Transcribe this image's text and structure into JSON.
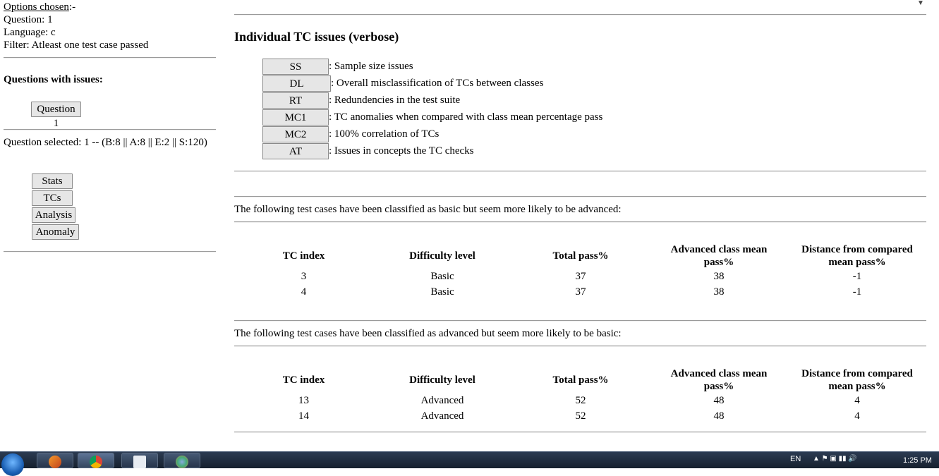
{
  "options": {
    "heading": "Options chosen",
    "heading_suffix": ":-",
    "question": "Question: 1",
    "language": "Language: c",
    "filter": "Filter: Atleast one test case passed"
  },
  "questions_with_issues": {
    "heading": "Questions with issues:",
    "items": [
      "Question 1"
    ]
  },
  "question_selected": "Question selected: 1 -- (B:8 || A:8 || E:2 || S:120)",
  "nav_buttons": [
    "Stats",
    "TCs",
    "Analysis",
    "Anomaly"
  ],
  "main": {
    "title": "Individual TC issues (verbose)",
    "legend": [
      {
        "code": "SS",
        "desc": ": Sample size issues"
      },
      {
        "code": "DL",
        "desc": ": Overall misclassification of TCs between classes"
      },
      {
        "code": "RT",
        "desc": ": Redundencies in the test suite"
      },
      {
        "code": "MC1",
        "desc": ": TC anomalies when compared with class mean percentage pass"
      },
      {
        "code": "MC2",
        "desc": ": 100% correlation of TCs"
      },
      {
        "code": "AT",
        "desc": ": Issues in concepts the TC checks"
      }
    ],
    "section1": {
      "text": "The following test cases have been classified as basic but seem more likely to be advanced:",
      "headers": [
        "TC index",
        "Difficulty level",
        "Total pass%",
        "Advanced class mean pass%",
        "Distance from compared mean pass%"
      ],
      "rows": [
        [
          "3",
          "Basic",
          "37",
          "38",
          "-1"
        ],
        [
          "4",
          "Basic",
          "37",
          "38",
          "-1"
        ]
      ]
    },
    "section2": {
      "text": "The following test cases have been classified as advanced but seem more likely to be basic:",
      "headers": [
        "TC index",
        "Difficulty level",
        "Total pass%",
        "Advanced class mean pass%",
        "Distance from compared mean pass%"
      ],
      "rows": [
        [
          "13",
          "Advanced",
          "52",
          "48",
          "4"
        ],
        [
          "14",
          "Advanced",
          "52",
          "48",
          "4"
        ]
      ]
    }
  },
  "taskbar": {
    "language": "EN",
    "time": "1:25 PM",
    "apps": [
      "start-orb",
      "matlab",
      "chrome",
      "notepad",
      "paint"
    ]
  }
}
